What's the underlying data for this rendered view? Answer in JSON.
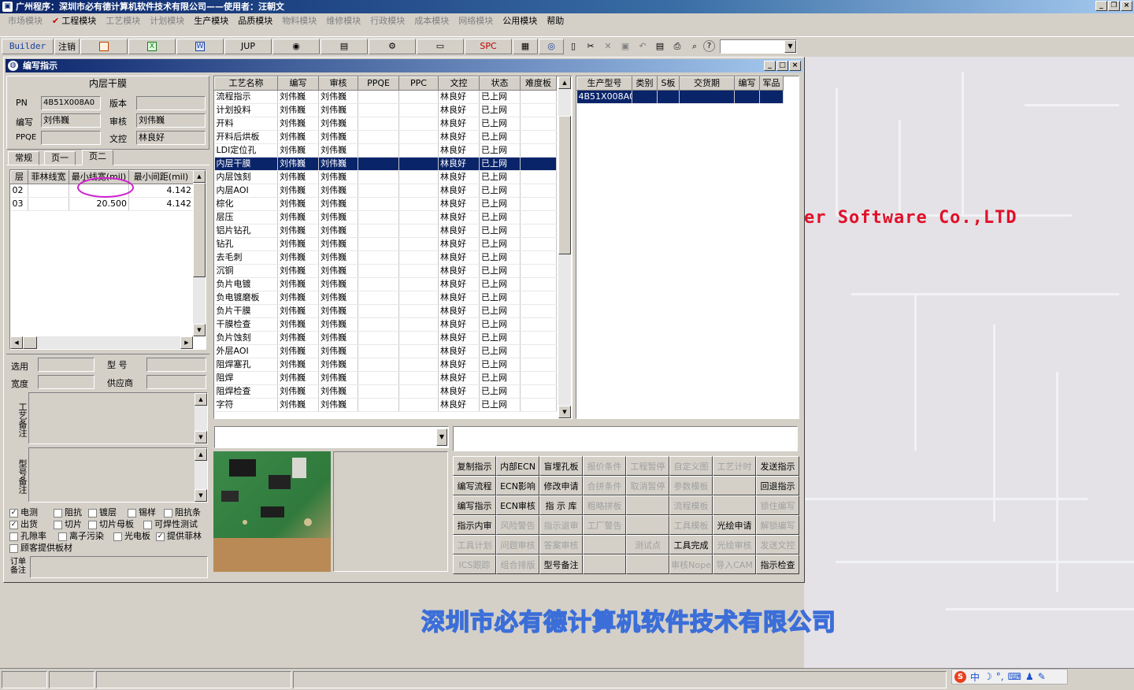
{
  "window": {
    "title": "广州程序：深圳市必有德计算机软件技术有限公司——使用者：汪朝文"
  },
  "menu": [
    {
      "label": "市场模块",
      "disabled": true,
      "checked": false
    },
    {
      "label": "工程模块",
      "disabled": false,
      "checked": true
    },
    {
      "label": "工艺模块",
      "disabled": true,
      "checked": false
    },
    {
      "label": "计划模块",
      "disabled": true,
      "checked": false
    },
    {
      "label": "生产模块",
      "disabled": false,
      "checked": false
    },
    {
      "label": "品质模块",
      "disabled": false,
      "checked": false
    },
    {
      "label": "物料模块",
      "disabled": true,
      "checked": false
    },
    {
      "label": "维修模块",
      "disabled": true,
      "checked": false
    },
    {
      "label": "行政模块",
      "disabled": true,
      "checked": false
    },
    {
      "label": "成本模块",
      "disabled": true,
      "checked": false
    },
    {
      "label": "网络模块",
      "disabled": true,
      "checked": false
    },
    {
      "label": "公用模块",
      "disabled": false,
      "checked": false
    },
    {
      "label": "帮助",
      "disabled": false,
      "checked": false
    }
  ],
  "toolbar": {
    "builder": "Builder",
    "logout": "注销",
    "jup": "JUP",
    "spc": "SPC"
  },
  "subwindow": {
    "title": "编写指示"
  },
  "info": {
    "heading": "内层干膜",
    "pn_label": "PN",
    "pn_value": "4B51X008A0",
    "version_label": "版本",
    "version_value": "",
    "writer_label": "编写",
    "writer_value": "刘伟巍",
    "review_label": "审核",
    "review_value": "刘伟巍",
    "ppqe_label": "PPQE",
    "ppqe_value": "",
    "control_label": "文控",
    "control_value": "林良好"
  },
  "tabs": [
    "常规",
    "页一",
    "页二"
  ],
  "layer_table": {
    "columns": [
      "层",
      "菲林线宽",
      "最小线宽(mil)",
      "最小间距(mil)"
    ],
    "rows": [
      [
        "02",
        "",
        "",
        "4.142"
      ],
      [
        "03",
        "",
        "20.500",
        "4.142"
      ]
    ]
  },
  "lower_form": {
    "select_label": "选用",
    "type_label": "型 号",
    "width_label": "宽度",
    "supplier_label": "供应商",
    "process_note_label": "工艺备注",
    "model_note_label": "型号备注",
    "order_note_label": "订单备注"
  },
  "checkboxes": [
    [
      {
        "label": "电测",
        "checked": true
      },
      {
        "label": "阻抗",
        "checked": false
      },
      {
        "label": "镀层",
        "checked": false
      },
      {
        "label": "锡样",
        "checked": false
      },
      {
        "label": "阻抗条",
        "checked": false
      }
    ],
    [
      {
        "label": "出货",
        "checked": true
      },
      {
        "label": "切片",
        "checked": false
      },
      {
        "label": "切片母板",
        "checked": false
      },
      {
        "label": "可焊性测试",
        "checked": false
      }
    ],
    [
      {
        "label": "孔隙率",
        "checked": false
      },
      {
        "label": "离子污染",
        "checked": false
      },
      {
        "label": "光电板",
        "checked": false
      },
      {
        "label": "提供菲林",
        "checked": true
      }
    ],
    [
      {
        "label": "顾客提供板材",
        "checked": false
      }
    ]
  ],
  "process_table": {
    "columns": [
      "工艺名称",
      "编写",
      "审核",
      "PPQE",
      "PPC",
      "文控",
      "状态",
      "难度板"
    ],
    "rows": [
      [
        "流程指示",
        "刘伟巍",
        "刘伟巍",
        "",
        "",
        "林良好",
        "已上网",
        ""
      ],
      [
        "计划投料",
        "刘伟巍",
        "刘伟巍",
        "",
        "",
        "林良好",
        "已上网",
        ""
      ],
      [
        "开料",
        "刘伟巍",
        "刘伟巍",
        "",
        "",
        "林良好",
        "已上网",
        ""
      ],
      [
        "开料后烘板",
        "刘伟巍",
        "刘伟巍",
        "",
        "",
        "林良好",
        "已上网",
        ""
      ],
      [
        "LDI定位孔",
        "刘伟巍",
        "刘伟巍",
        "",
        "",
        "林良好",
        "已上网",
        ""
      ],
      [
        "内层干膜",
        "刘伟巍",
        "刘伟巍",
        "",
        "",
        "林良好",
        "已上网",
        ""
      ],
      [
        "内层蚀刻",
        "刘伟巍",
        "刘伟巍",
        "",
        "",
        "林良好",
        "已上网",
        ""
      ],
      [
        "内层AOI",
        "刘伟巍",
        "刘伟巍",
        "",
        "",
        "林良好",
        "已上网",
        ""
      ],
      [
        "棕化",
        "刘伟巍",
        "刘伟巍",
        "",
        "",
        "林良好",
        "已上网",
        ""
      ],
      [
        "层压",
        "刘伟巍",
        "刘伟巍",
        "",
        "",
        "林良好",
        "已上网",
        ""
      ],
      [
        "铝片钻孔",
        "刘伟巍",
        "刘伟巍",
        "",
        "",
        "林良好",
        "已上网",
        ""
      ],
      [
        "钻孔",
        "刘伟巍",
        "刘伟巍",
        "",
        "",
        "林良好",
        "已上网",
        ""
      ],
      [
        "去毛刺",
        "刘伟巍",
        "刘伟巍",
        "",
        "",
        "林良好",
        "已上网",
        ""
      ],
      [
        "沉铜",
        "刘伟巍",
        "刘伟巍",
        "",
        "",
        "林良好",
        "已上网",
        ""
      ],
      [
        "负片电镀",
        "刘伟巍",
        "刘伟巍",
        "",
        "",
        "林良好",
        "已上网",
        ""
      ],
      [
        "负电镀磨板",
        "刘伟巍",
        "刘伟巍",
        "",
        "",
        "林良好",
        "已上网",
        ""
      ],
      [
        "负片干膜",
        "刘伟巍",
        "刘伟巍",
        "",
        "",
        "林良好",
        "已上网",
        ""
      ],
      [
        "干膜检查",
        "刘伟巍",
        "刘伟巍",
        "",
        "",
        "林良好",
        "已上网",
        ""
      ],
      [
        "负片蚀刻",
        "刘伟巍",
        "刘伟巍",
        "",
        "",
        "林良好",
        "已上网",
        ""
      ],
      [
        "外层AOI",
        "刘伟巍",
        "刘伟巍",
        "",
        "",
        "林良好",
        "已上网",
        ""
      ],
      [
        "阻焊塞孔",
        "刘伟巍",
        "刘伟巍",
        "",
        "",
        "林良好",
        "已上网",
        ""
      ],
      [
        "阻焊",
        "刘伟巍",
        "刘伟巍",
        "",
        "",
        "林良好",
        "已上网",
        ""
      ],
      [
        "阻焊检查",
        "刘伟巍",
        "刘伟巍",
        "",
        "",
        "林良好",
        "已上网",
        ""
      ],
      [
        "字符",
        "刘伟巍",
        "刘伟巍",
        "",
        "",
        "林良好",
        "已上网",
        ""
      ]
    ],
    "selected_index": 5
  },
  "product_table": {
    "columns": [
      "生产型号",
      "类别",
      "S板",
      "交货期",
      "编写",
      "军品"
    ],
    "rows": [
      [
        "4B51X008A0",
        "",
        "",
        "",
        "",
        ""
      ]
    ]
  },
  "buttons": [
    [
      {
        "label": "复制指示",
        "enabled": true
      },
      {
        "label": "内部ECN",
        "enabled": true
      },
      {
        "label": "盲埋孔板",
        "enabled": true
      },
      {
        "label": "报价条件",
        "enabled": false
      },
      {
        "label": "工程暂停",
        "enabled": false
      },
      {
        "label": "自定义图",
        "enabled": false
      },
      {
        "label": "工艺计时",
        "enabled": false
      },
      {
        "label": "发送指示",
        "enabled": true
      }
    ],
    [
      {
        "label": "编写流程",
        "enabled": true
      },
      {
        "label": "ECN影响",
        "enabled": true
      },
      {
        "label": "修改申请",
        "enabled": true
      },
      {
        "label": "合拼条件",
        "enabled": false
      },
      {
        "label": "取消暂停",
        "enabled": false
      },
      {
        "label": "参数模板",
        "enabled": false
      },
      {
        "label": "",
        "enabled": false
      },
      {
        "label": "回退指示",
        "enabled": true
      }
    ],
    [
      {
        "label": "编写指示",
        "enabled": true
      },
      {
        "label": "ECN审核",
        "enabled": true
      },
      {
        "label": "指 示 库",
        "enabled": true
      },
      {
        "label": "粗略拼板",
        "enabled": false
      },
      {
        "label": "",
        "enabled": false
      },
      {
        "label": "流程模板",
        "enabled": false
      },
      {
        "label": "",
        "enabled": false
      },
      {
        "label": "锁住编写",
        "enabled": false
      }
    ],
    [
      {
        "label": "指示内审",
        "enabled": true
      },
      {
        "label": "风险警告",
        "enabled": false
      },
      {
        "label": "指示退审",
        "enabled": false
      },
      {
        "label": "工厂警告",
        "enabled": false
      },
      {
        "label": "",
        "enabled": false
      },
      {
        "label": "工具模板",
        "enabled": false
      },
      {
        "label": "光绘申请",
        "enabled": true
      },
      {
        "label": "解锁编写",
        "enabled": false
      }
    ],
    [
      {
        "label": "工具计划",
        "enabled": false
      },
      {
        "label": "问题审核",
        "enabled": false
      },
      {
        "label": "答案审核",
        "enabled": false
      },
      {
        "label": "",
        "enabled": false
      },
      {
        "label": "测试点",
        "enabled": false
      },
      {
        "label": "工具完成",
        "enabled": true
      },
      {
        "label": "光绘审核",
        "enabled": false
      },
      {
        "label": "发送文控",
        "enabled": false
      }
    ],
    [
      {
        "label": "ICS跟踪",
        "enabled": false
      },
      {
        "label": "组合排版",
        "enabled": false
      },
      {
        "label": "型号备注",
        "enabled": true
      },
      {
        "label": "",
        "enabled": false
      },
      {
        "label": "",
        "enabled": false
      },
      {
        "label": "审核Nope",
        "enabled": false
      },
      {
        "label": "导入CAM",
        "enabled": false
      },
      {
        "label": "指示检查",
        "enabled": true
      }
    ]
  ],
  "desktop": {
    "software_text": "er Software Co.,LTD",
    "company_text": "深圳市必有德计算机软件技术有限公司"
  },
  "ime": {
    "label": "中"
  },
  "colors": {
    "title_start": "#0a246a",
    "title_end": "#a6caf0",
    "selection": "#0a246a",
    "accent_red": "#e0102a",
    "company_blue": "#3b6ed8"
  }
}
